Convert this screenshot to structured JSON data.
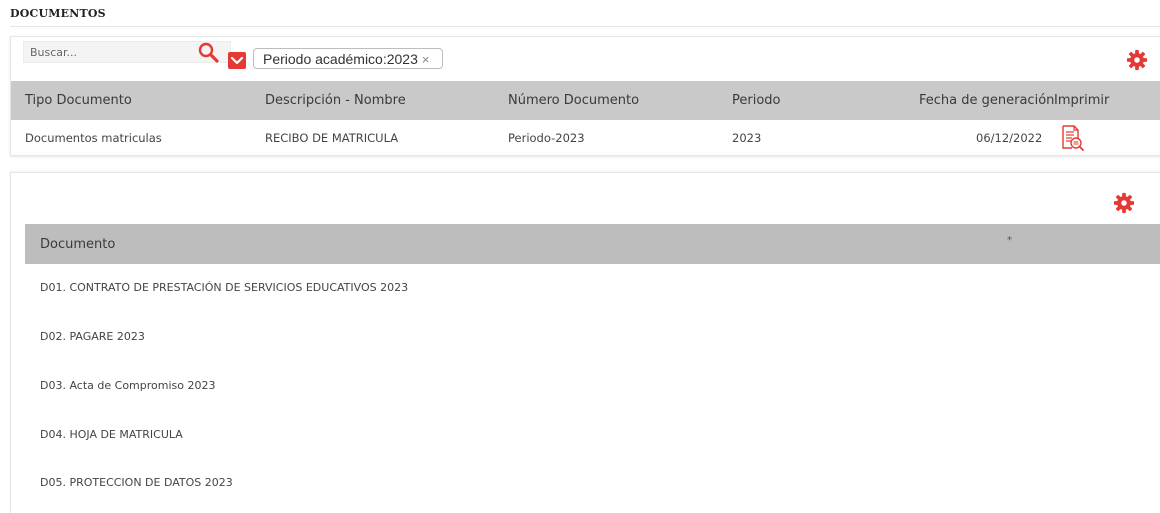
{
  "page": {
    "title": "DOCUMENTOS"
  },
  "search": {
    "placeholder": "Buscar...",
    "value": ""
  },
  "filter": {
    "chip_label": "Periodo académico:2023",
    "chip_close": "×"
  },
  "table1": {
    "headers": [
      "Tipo Documento",
      "Descripción - Nombre",
      "Número Documento",
      "Periodo",
      "Fecha de generación",
      "Imprimir"
    ],
    "rows": [
      [
        "Documentos matriculas",
        "RECIBO DE MATRICULA",
        "Periodo-2023",
        "2023",
        "06/12/2022"
      ]
    ]
  },
  "table2": {
    "header": "Documento",
    "header_extra": "*",
    "items": [
      "D01. CONTRATO DE PRESTACIÓN DE SERVICIOS EDUCATIVOS 2023",
      "D02. PAGARE 2023",
      "D03. Acta de Compromiso 2023",
      "D04. HOJA DE MATRICULA",
      "D05. PROTECCION DE DATOS 2023"
    ]
  },
  "colors": {
    "accent": "#e53935",
    "header_bg": "#c9c9c9",
    "header_bg_2": "#bdbdbd"
  },
  "icons": [
    "search-icon",
    "chevron-down-icon",
    "close-icon",
    "gear-icon",
    "document-search-icon"
  ]
}
